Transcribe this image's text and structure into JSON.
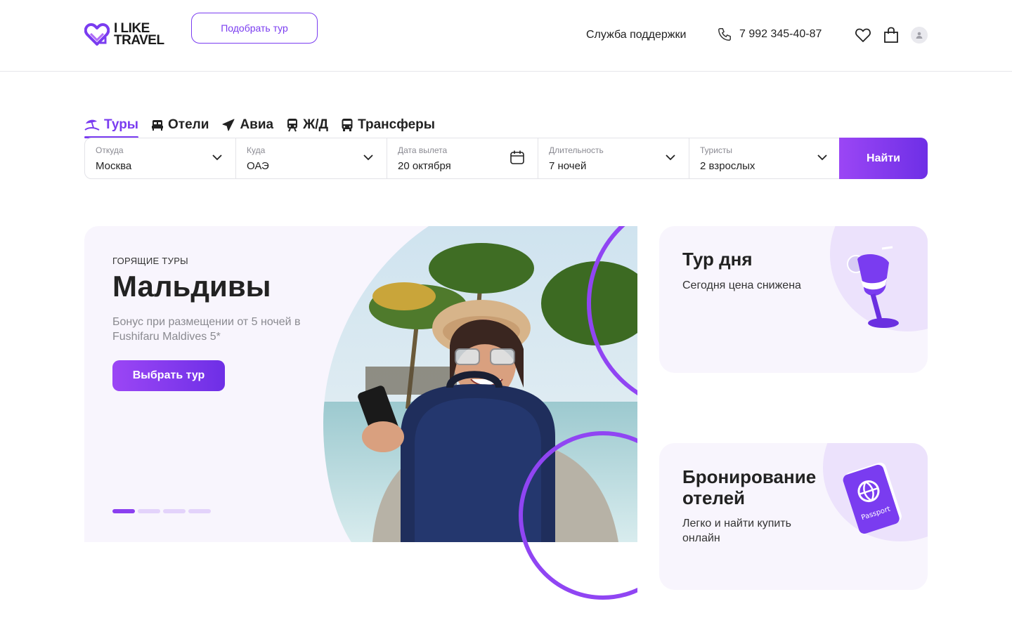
{
  "header": {
    "logo_line1": "I LIKE",
    "logo_line2": "TRAVEL",
    "pick_tour_label": "Подобрать тур",
    "support_label": "Служба поддержки",
    "phone": "7 992 345-40-87",
    "icons": [
      "phone-icon",
      "heart-icon",
      "bag-icon",
      "user-icon"
    ]
  },
  "tabs": [
    {
      "label": "Туры",
      "icon": "beach-icon",
      "active": true
    },
    {
      "label": "Отели",
      "icon": "bed-icon",
      "active": false
    },
    {
      "label": "Авиа",
      "icon": "plane-icon",
      "active": false
    },
    {
      "label": "Ж/Д",
      "icon": "train-icon",
      "active": false
    },
    {
      "label": "Трансферы",
      "icon": "bus-icon",
      "active": false
    }
  ],
  "search": {
    "fields": [
      {
        "label": "Откуда",
        "value": "Москва",
        "icon": "chevron-down-icon"
      },
      {
        "label": "Куда",
        "value": "ОАЭ",
        "icon": "chevron-down-icon"
      },
      {
        "label": "Дата вылета",
        "value": "20 октября",
        "icon": "calendar-icon"
      },
      {
        "label": "Длительность",
        "value": "7 ночей",
        "icon": "chevron-down-icon"
      },
      {
        "label": "Туристы",
        "value": "2 взрослых",
        "icon": "chevron-down-icon"
      }
    ],
    "submit_label": "Найти"
  },
  "hero": {
    "kicker": "ГОРЯЩИЕ ТУРЫ",
    "title": "Мальдивы",
    "description": "Бонус при размещении от 5 ночей в Fushifaru Maldives 5*",
    "button_label": "Выбрать тур",
    "slides_total": 4,
    "active_slide": 1
  },
  "cards": [
    {
      "title": "Тур дня",
      "subtitle": "Сегодня цена снижена",
      "icon": "cocktail-icon"
    },
    {
      "title": "Бронирование отелей",
      "subtitle": "Легко и найти купить онлайн",
      "icon": "passport-icon",
      "icon_text": "Passport"
    }
  ],
  "colors": {
    "accent": "#7a3cf0",
    "accent_gradient_start": "#9b46f5",
    "accent_gradient_end": "#6e2fe6",
    "card_bg": "#f8f5fd"
  }
}
